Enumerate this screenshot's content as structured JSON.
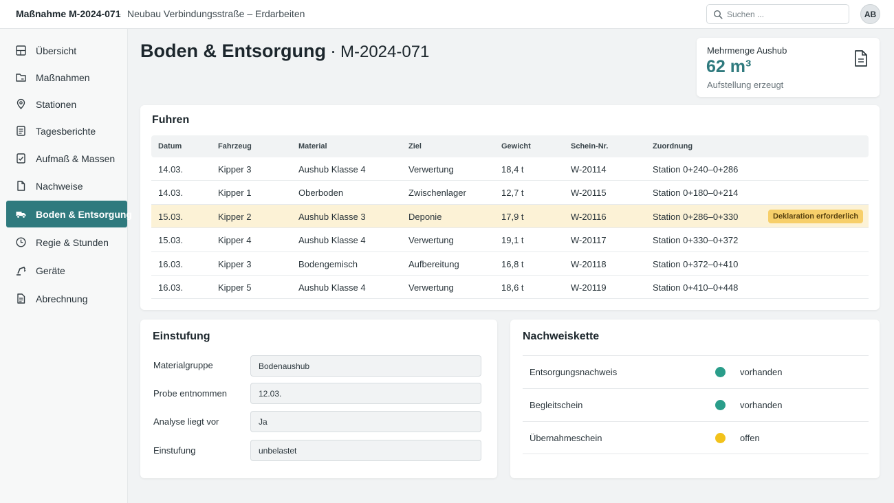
{
  "topbar": {
    "title": "Maßnahme M-2024-071",
    "separator": "·",
    "subtitle": "Neubau Verbindungsstraße – Erdarbeiten",
    "search_placeholder": "Suchen ...",
    "avatar_initials": "AB"
  },
  "sidebar": {
    "items": [
      {
        "label": "Übersicht",
        "icon": "dashboard-icon"
      },
      {
        "label": "Maßnahmen",
        "icon": "folder-icon"
      },
      {
        "label": "Stationen",
        "icon": "map-pin-icon"
      },
      {
        "label": "Tagesberichte",
        "icon": "report-icon"
      },
      {
        "label": "Aufmaß & Massen",
        "icon": "measure-icon"
      },
      {
        "label": "Nachweise",
        "icon": "document-icon"
      },
      {
        "label": "Boden & Entsorgung",
        "icon": "truck-icon",
        "active": true
      },
      {
        "label": "Regie & Stunden",
        "icon": "clock-icon"
      },
      {
        "label": "Geräte",
        "icon": "excavator-icon"
      },
      {
        "label": "Abrechnung",
        "icon": "invoice-icon"
      }
    ]
  },
  "header": {
    "title": "Boden & Entsorgung",
    "separator": "·",
    "code": "M-2024-071"
  },
  "summary": {
    "label": "Mehrmenge Aushub",
    "value": "62 m³",
    "sub": "Aufstellung erzeugt"
  },
  "fuhren": {
    "title": "Fuhren",
    "columns": [
      "Datum",
      "Fahrzeug",
      "Material",
      "Ziel",
      "Gewicht",
      "Schein-Nr.",
      "Zuordnung"
    ],
    "rows": [
      [
        "14.03.",
        "Kipper 3",
        "Aushub Klasse 4",
        "Verwertung",
        "18,4 t",
        "W-20114",
        "Station 0+240–0+286"
      ],
      [
        "14.03.",
        "Kipper 1",
        "Oberboden",
        "Zwischenlager",
        "12,7 t",
        "W-20115",
        "Station 0+180–0+214"
      ],
      [
        "15.03.",
        "Kipper 2",
        "Aushub Klasse 3",
        "Deponie",
        "17,9 t",
        "W-20116",
        "Station 0+286–0+330"
      ],
      [
        "15.03.",
        "Kipper 4",
        "Aushub Klasse 4",
        "Verwertung",
        "19,1 t",
        "W-20117",
        "Station 0+330–0+372"
      ],
      [
        "16.03.",
        "Kipper 3",
        "Bodengemisch",
        "Aufbereitung",
        "16,8 t",
        "W-20118",
        "Station 0+372–0+410"
      ],
      [
        "16.03.",
        "Kipper 5",
        "Aushub Klasse 4",
        "Verwertung",
        "18,6 t",
        "W-20119",
        "Station 0+410–0+448"
      ]
    ],
    "highlight_badge": "Deklaration erforderlich"
  },
  "einstufung": {
    "title": "Einstufung",
    "fields": [
      {
        "label": "Materialgruppe",
        "value": "Bodenaushub"
      },
      {
        "label": "Probe entnommen",
        "value": "12.03."
      },
      {
        "label": "Analyse liegt vor",
        "value": "Ja"
      },
      {
        "label": "Einstufung",
        "value": "unbelastet"
      }
    ]
  },
  "nachweiskette": {
    "title": "Nachweiskette",
    "items": [
      {
        "label": "Entsorgungsnachweis",
        "status": "vorhanden",
        "color": "#2a9d8a"
      },
      {
        "label": "Begleitschein",
        "status": "vorhanden",
        "color": "#2a9d8a"
      },
      {
        "label": "Übernahmeschein",
        "status": "offen",
        "color": "#f2c21b"
      }
    ]
  },
  "colors": {
    "accent": "#2f7a7e",
    "highlight_row": "#fcf2d6",
    "badge": "#f7cf6a"
  }
}
